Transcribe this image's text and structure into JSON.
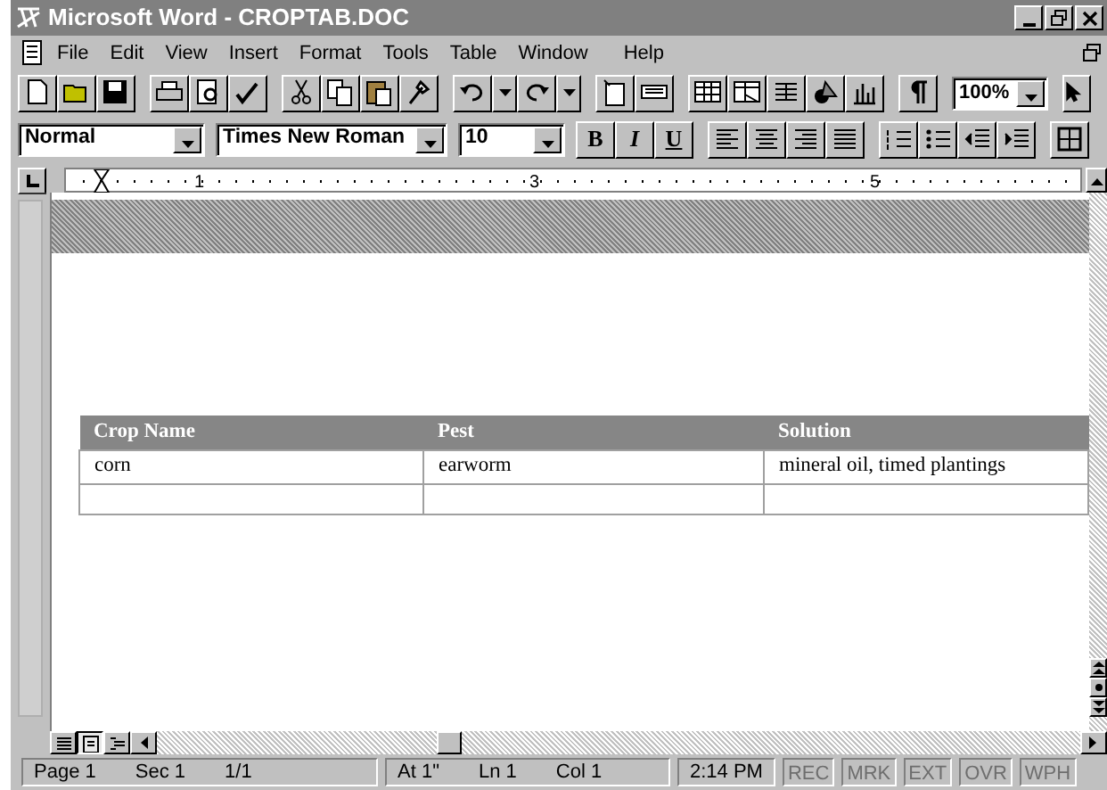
{
  "window": {
    "title": "Microsoft Word - CROPTAB.DOC"
  },
  "menu": [
    "File",
    "Edit",
    "View",
    "Insert",
    "Format",
    "Tools",
    "Table",
    "Window",
    "Help"
  ],
  "toolbar": {
    "zoom": "100%"
  },
  "formatting": {
    "style": "Normal",
    "font": "Times New Roman",
    "size": "10",
    "bold": "B",
    "italic": "I",
    "underline": "U"
  },
  "ruler": {
    "labels": [
      "1",
      "3",
      "5"
    ]
  },
  "table": {
    "columns": [
      "Crop Name",
      "Pest",
      "Solution"
    ],
    "rows": [
      [
        "corn",
        "earworm",
        "mineral oil, timed plantings"
      ],
      [
        "",
        "",
        ""
      ]
    ]
  },
  "view_buttons": [
    {
      "selected": false
    },
    {
      "selected": true
    },
    {
      "selected": false
    }
  ],
  "status_bar": {
    "groups": [
      [
        "Page 1",
        "Sec 1",
        "1/1"
      ],
      [
        "At 1\"",
        "Ln 1",
        "Col 1"
      ],
      [
        "2:14 PM"
      ]
    ],
    "indicators": [
      {
        "label": "REC",
        "disabled": true
      },
      {
        "label": "MRK",
        "disabled": true
      },
      {
        "label": "EXT",
        "disabled": true
      },
      {
        "label": "OVR",
        "disabled": true
      },
      {
        "label": "WPH",
        "disabled": true
      }
    ]
  }
}
